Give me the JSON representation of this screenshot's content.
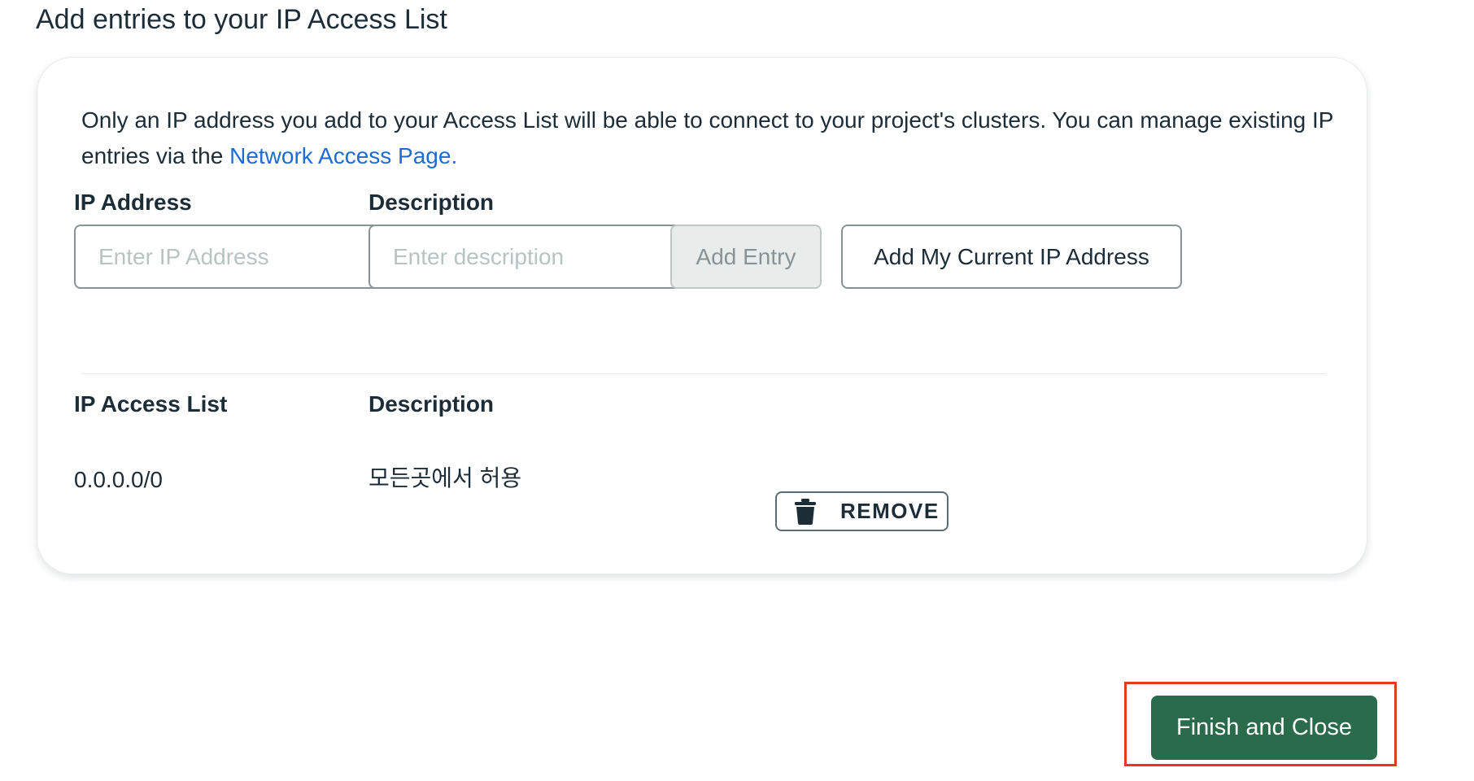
{
  "page": {
    "title": "Add entries to your IP Access List"
  },
  "intro": {
    "text": "Only an IP address you add to your Access List will be able to connect to your project's clusters. You can manage existing IP entries via the ",
    "link_label": "Network Access Page."
  },
  "form": {
    "ip_label": "IP Address",
    "ip_placeholder": "Enter IP Address",
    "ip_value": "",
    "description_label": "Description",
    "description_placeholder": "Enter description",
    "description_value": "",
    "add_entry_label": "Add Entry",
    "add_current_ip_label": "Add My Current IP Address"
  },
  "access_list": {
    "header_ip": "IP Access List",
    "header_description": "Description",
    "rows": [
      {
        "ip": "0.0.0.0/0",
        "description": "모든곳에서 허용",
        "remove_label": "REMOVE",
        "remove_icon": "trash-icon"
      }
    ]
  },
  "footer": {
    "finish_label": "Finish and Close"
  },
  "colors": {
    "primary_green": "#2a6b4b",
    "link_blue": "#1e6bd6",
    "highlight_red": "#e03a22",
    "text_dark": "#1c2d38"
  }
}
